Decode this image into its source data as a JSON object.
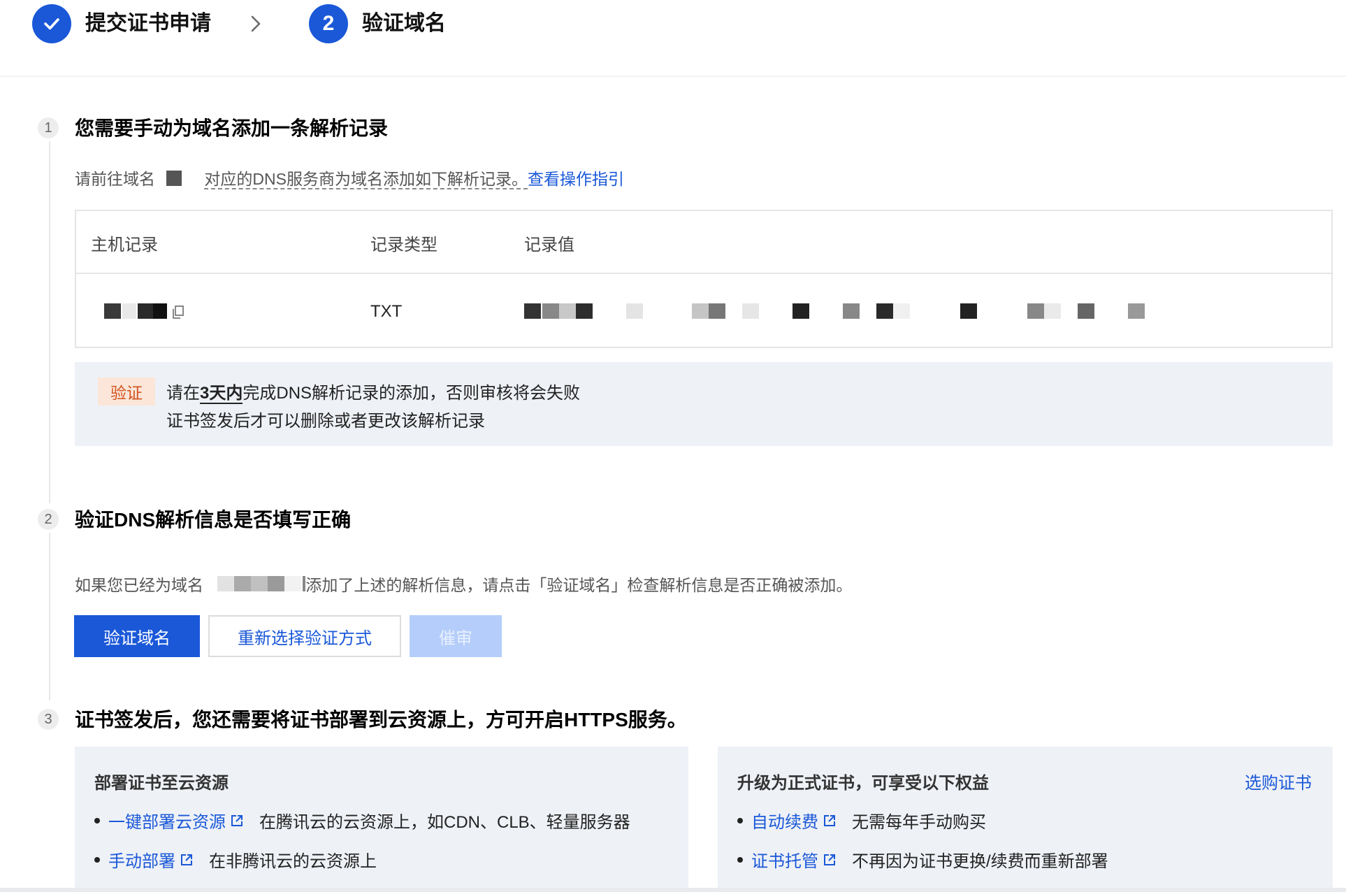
{
  "stepper": {
    "step1_label": "提交证书申请",
    "step2_number": "2",
    "step2_label": "验证域名"
  },
  "section1": {
    "number": "1",
    "title": "您需要手动为域名添加一条解析记录",
    "desc_prefix": "请前往域名",
    "desc_mid": "对应的DNS服务商为域名添加如下解析记录。",
    "guide_link": "查看操作指引",
    "table": {
      "headers": [
        "主机记录",
        "记录类型",
        "记录值"
      ],
      "row": {
        "host": "",
        "type": "TXT",
        "value": ""
      }
    },
    "notice": {
      "tag": "验证",
      "line1_prefix": "请在",
      "line1_bold": "3天内",
      "line1_suffix": "完成DNS解析记录的添加，否则审核将会失败",
      "line2": "证书签发后才可以删除或者更改该解析记录"
    }
  },
  "section2": {
    "number": "2",
    "title": "验证DNS解析信息是否填写正确",
    "desc_prefix": "如果您已经为域名",
    "desc_suffix": "添加了上述的解析信息，请点击「验证域名」检查解析信息是否正确被添加。",
    "buttons": {
      "verify": "验证域名",
      "reselect": "重新选择验证方式",
      "urge": "催审"
    }
  },
  "section3": {
    "number": "3",
    "title": "证书签发后，您还需要将证书部署到云资源上，方可开启HTTPS服务。",
    "deploy_card": {
      "title": "部署证书至云资源",
      "items": [
        {
          "link": "一键部署云资源",
          "text": "在腾讯云的云资源上，如CDN、CLB、轻量服务器"
        },
        {
          "link": "手动部署",
          "text": "在非腾讯云的云资源上"
        }
      ]
    },
    "upgrade_card": {
      "title": "升级为正式证书，可享受以下权益",
      "action_link": "选购证书",
      "items": [
        {
          "link": "自动续费",
          "text": "无需每年手动购买"
        },
        {
          "link": "证书托管",
          "text": "不再因为证书更换/续费而重新部署"
        }
      ]
    }
  },
  "colors": {
    "primary": "#1a58d8",
    "primary_disabled": "#b4cdfa",
    "notice_bg": "#eef1f6",
    "tag_bg": "#fbe6d9",
    "tag_text": "#d2511d"
  }
}
